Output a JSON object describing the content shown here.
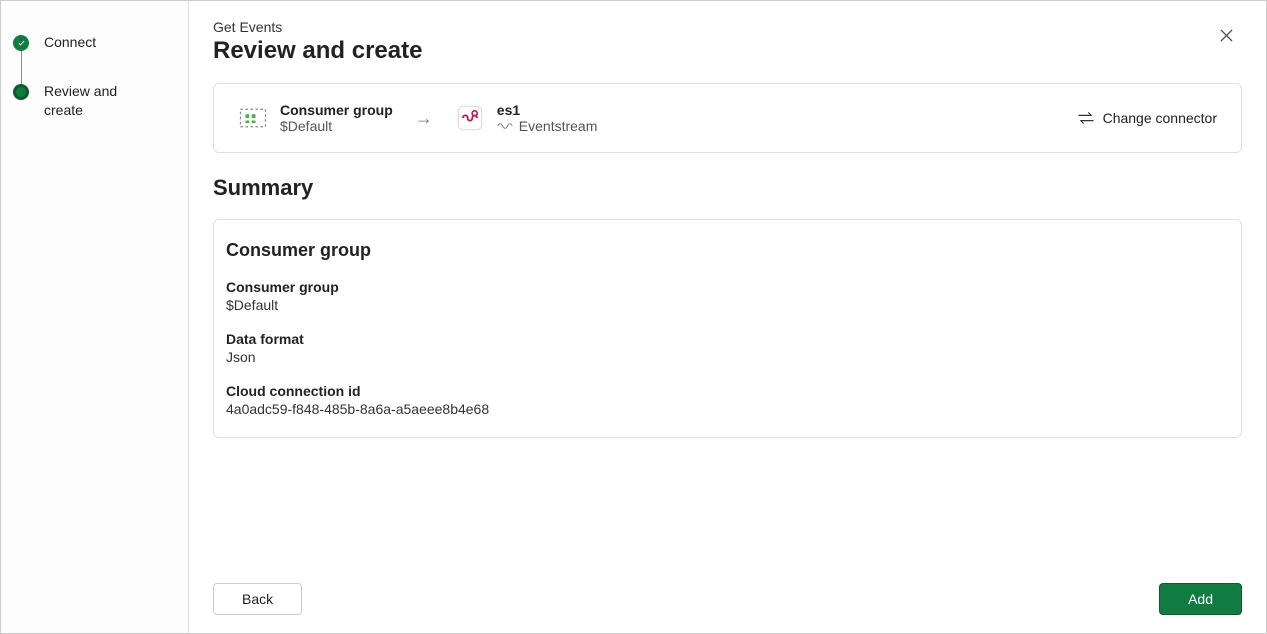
{
  "sidebar": {
    "steps": [
      {
        "label": "Connect",
        "state": "completed"
      },
      {
        "label": "Review and create",
        "state": "current"
      }
    ]
  },
  "header": {
    "breadcrumb": "Get Events",
    "title": "Review and create"
  },
  "connector": {
    "source": {
      "title": "Consumer group",
      "value": "$Default"
    },
    "destination": {
      "title": "es1",
      "type": "Eventstream"
    },
    "change_label": "Change connector"
  },
  "summary": {
    "title": "Summary",
    "group": {
      "title": "Consumer group",
      "fields": [
        {
          "label": "Consumer group",
          "value": "$Default"
        },
        {
          "label": "Data format",
          "value": "Json"
        },
        {
          "label": "Cloud connection id",
          "value": "4a0adc59-f848-485b-8a6a-a5aeee8b4e68"
        }
      ]
    }
  },
  "footer": {
    "back": "Back",
    "add": "Add"
  }
}
